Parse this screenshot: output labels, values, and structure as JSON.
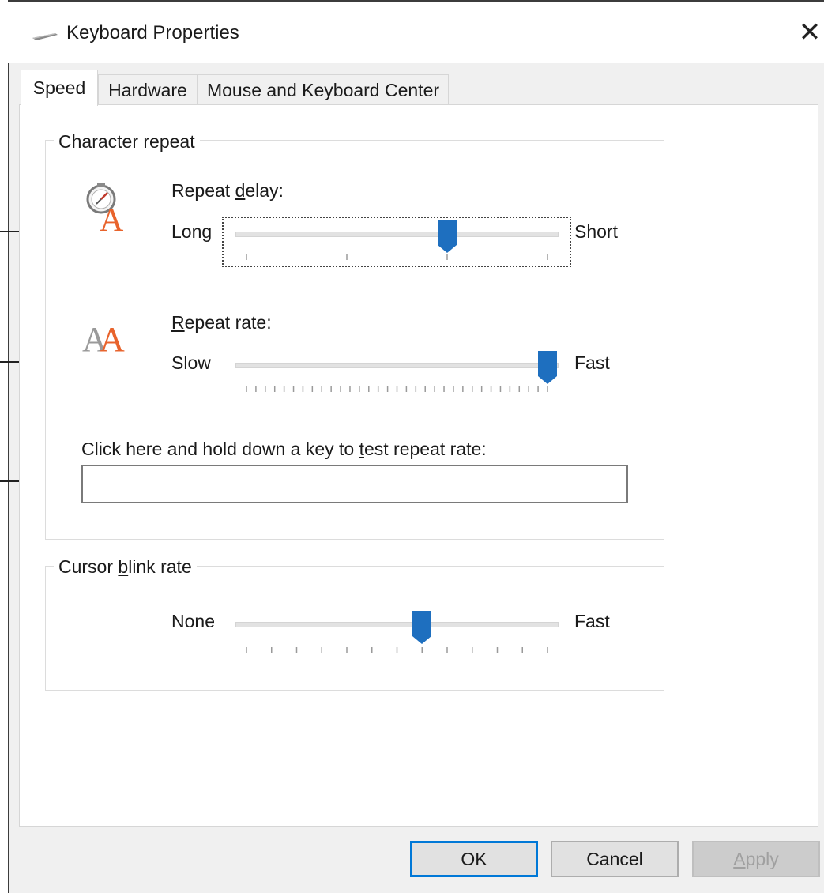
{
  "window": {
    "title": "Keyboard Properties",
    "close_symbol": "✕",
    "icon": "keyboard-icon"
  },
  "tabs": [
    {
      "label": "Speed",
      "active": true
    },
    {
      "label": "Hardware",
      "active": false
    },
    {
      "label": "Mouse and Keyboard Center",
      "active": false
    }
  ],
  "character_repeat": {
    "group_title": "Character repeat",
    "repeat_delay": {
      "label_prefix": "Repeat ",
      "label_underlined": "d",
      "label_suffix": "elay:",
      "min_label": "Long",
      "max_label": "Short",
      "value": 2,
      "max": 3,
      "icon": "clock-letter-icon"
    },
    "repeat_rate": {
      "label_underlined": "R",
      "label_suffix": "epeat rate:",
      "min_label": "Slow",
      "max_label": "Fast",
      "value": 32,
      "max": 32,
      "icon": "double-letter-icon"
    },
    "test": {
      "label_prefix": "Click here and hold down a key to ",
      "label_underlined": "t",
      "label_suffix": "est repeat rate:",
      "value": ""
    }
  },
  "cursor_blink": {
    "group_title_prefix": "Cursor ",
    "group_title_underlined": "b",
    "group_title_suffix": "link rate",
    "min_label": "None",
    "max_label": "Fast",
    "value": 7,
    "max": 12
  },
  "buttons": {
    "ok": "OK",
    "cancel": "Cancel",
    "apply_underlined": "A",
    "apply_suffix": "pply"
  },
  "colors": {
    "accent": "#1e6fbf",
    "tab_active_bg": "#ffffff"
  }
}
